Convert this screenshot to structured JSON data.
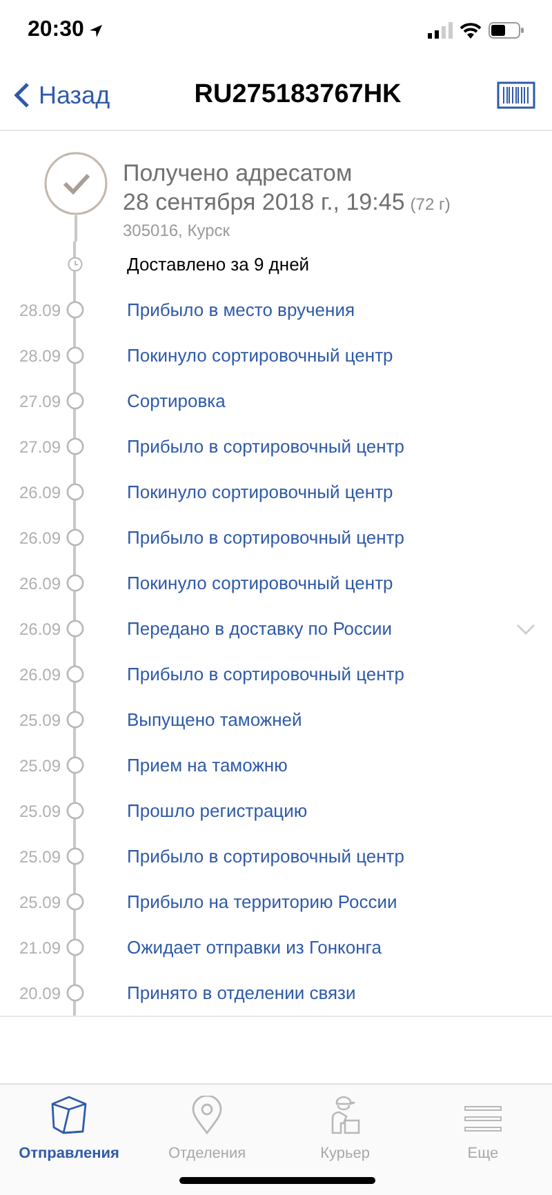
{
  "status_bar": {
    "time": "20:30"
  },
  "nav": {
    "back": "Назад",
    "title": "RU275183767HK"
  },
  "summary": {
    "status": "Получено адресатом",
    "date": "28 сентября 2018 г., 19:45",
    "weight": "(72 г)",
    "place": "305016, Курск"
  },
  "duration": "Доставлено за 9 дней",
  "events": [
    {
      "date": "28.09",
      "text": "Прибыло в место вручения",
      "expandable": false
    },
    {
      "date": "28.09",
      "text": "Покинуло сортировочный центр",
      "expandable": false
    },
    {
      "date": "27.09",
      "text": "Сортировка",
      "expandable": false
    },
    {
      "date": "27.09",
      "text": "Прибыло в сортировочный центр",
      "expandable": false
    },
    {
      "date": "26.09",
      "text": "Покинуло сортировочный центр",
      "expandable": false
    },
    {
      "date": "26.09",
      "text": "Прибыло в сортировочный центр",
      "expandable": false
    },
    {
      "date": "26.09",
      "text": "Покинуло сортировочный центр",
      "expandable": false
    },
    {
      "date": "26.09",
      "text": "Передано в доставку по России",
      "expandable": true
    },
    {
      "date": "26.09",
      "text": "Прибыло в сортировочный центр",
      "expandable": false
    },
    {
      "date": "25.09",
      "text": "Выпущено таможней",
      "expandable": false
    },
    {
      "date": "25.09",
      "text": "Прием на таможню",
      "expandable": false
    },
    {
      "date": "25.09",
      "text": "Прошло регистрацию",
      "expandable": false
    },
    {
      "date": "25.09",
      "text": "Прибыло в сортировочный центр",
      "expandable": false
    },
    {
      "date": "25.09",
      "text": "Прибыло на территорию России",
      "expandable": false
    },
    {
      "date": "21.09",
      "text": "Ожидает отправки из Гонконга",
      "expandable": false
    },
    {
      "date": "20.09",
      "text": "Принято в отделении связи",
      "expandable": false
    }
  ],
  "tabs": [
    {
      "kind": "box",
      "label": "Отправления",
      "selected": true
    },
    {
      "kind": "pin",
      "label": "Отделения",
      "selected": false
    },
    {
      "kind": "courier",
      "label": "Курьер",
      "selected": false
    },
    {
      "kind": "menu",
      "label": "Еще",
      "selected": false
    }
  ]
}
